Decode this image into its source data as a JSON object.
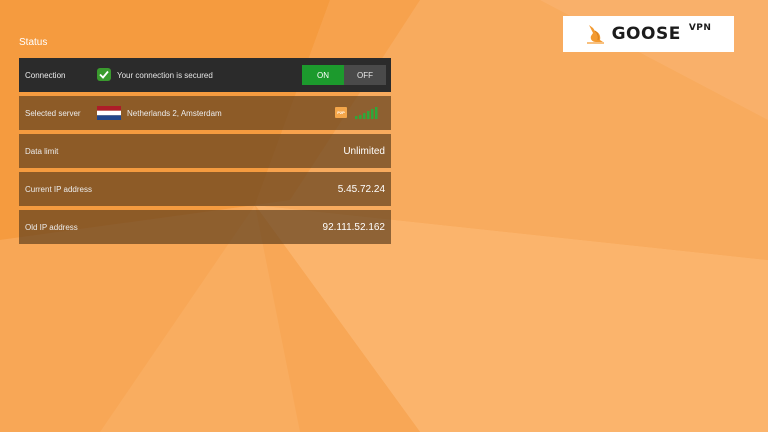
{
  "logo": {
    "name": "GOOSE",
    "sup": "VPN"
  },
  "status": {
    "title": "Status"
  },
  "connection": {
    "label": "Connection",
    "message": "Your connection is secured",
    "on_label": "ON",
    "off_label": "OFF",
    "state": "on"
  },
  "server": {
    "label": "Selected server",
    "name": "Netherlands 2, Amsterdam",
    "flag": "netherlands-flag-icon",
    "p2p_badge": "P2P"
  },
  "data_limit": {
    "label": "Data limit",
    "value": "Unlimited"
  },
  "current_ip": {
    "label": "Current IP address",
    "value": "5.45.72.24"
  },
  "old_ip": {
    "label": "Old IP address",
    "value": "92.111.52.162"
  },
  "colors": {
    "background": "#f7a04a",
    "on_green": "#1c9a2d",
    "off_gray": "#4a4a4a",
    "check_green": "#3a9a2e",
    "signal_green": "#2fa83a"
  }
}
